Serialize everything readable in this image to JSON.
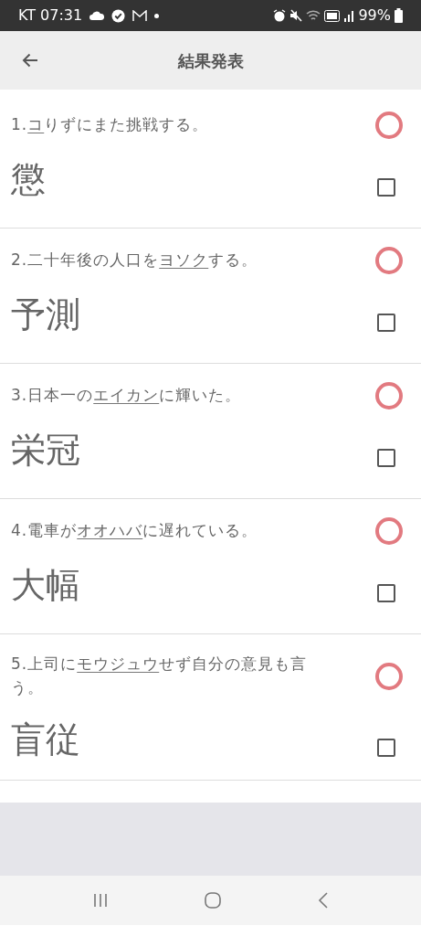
{
  "status_bar": {
    "carrier_time": "KT 07:31",
    "battery": "99%"
  },
  "app_bar": {
    "title": "結果発表"
  },
  "questions": [
    {
      "number": "1.",
      "underlined": "コ",
      "after": "りずにまた挑戦する。",
      "answer": "懲",
      "correct": true,
      "checked": false
    },
    {
      "number": "2.",
      "before": "二十年後の人口を",
      "underlined": "ヨソク",
      "after": "する。",
      "answer": "予測",
      "correct": true,
      "checked": false
    },
    {
      "number": "3.",
      "before": "日本一の",
      "underlined": "エイカン",
      "after": "に輝いた。",
      "answer": "栄冠",
      "correct": true,
      "checked": false
    },
    {
      "number": "4.",
      "before": "電車が",
      "underlined": "オオハバ",
      "after": "に遅れている。",
      "answer": "大幅",
      "correct": true,
      "checked": false
    },
    {
      "number": "5.",
      "before": "上司に",
      "underlined": "モウジュウ",
      "after": "せず自分の意見も言う。",
      "answer": "盲従",
      "correct": true,
      "checked": false
    }
  ]
}
